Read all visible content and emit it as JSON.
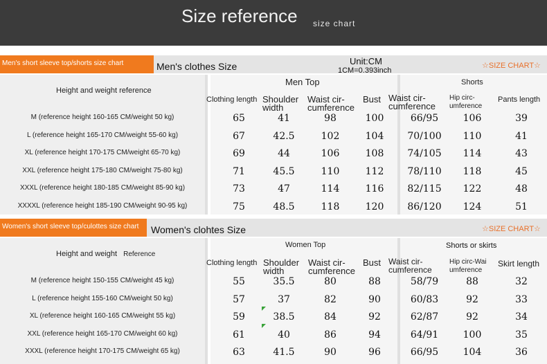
{
  "header": {
    "title": "Size reference",
    "subtitle": "size chart"
  },
  "men": {
    "tab_label": "Men's short sleeve top/shorts size chart",
    "section_label": "Men's clothes Size",
    "unit": "Unit:CM",
    "conversion": "1CM=0.393inch",
    "size_chart_label": "☆SIZE CHART☆",
    "ref_header": "Height and weight reference",
    "group_top": "Men Top",
    "group_shorts": "Shorts",
    "col_headers": {
      "clothing_length": "Clothing length",
      "shoulder_1": "Shoulder",
      "shoulder_2": "width",
      "waist_1": "Waist cir-",
      "waist_2": "cumference",
      "bust": "Bust",
      "s_waist_1": "Waist cir-",
      "s_waist_2": "cumference",
      "hip_1": "Hip circ-",
      "hip_2": "umference",
      "pants_length": "Pants length"
    },
    "rows": [
      {
        "ref": "M (reference height 160-165 CM/weight 50 kg)",
        "v": [
          "65",
          "41",
          "98",
          "100",
          "66/95",
          "106",
          "39"
        ]
      },
      {
        "ref": "L (reference height 165-170 CM/weight 55-60 kg)",
        "v": [
          "67",
          "42.5",
          "102",
          "104",
          "70/100",
          "110",
          "41"
        ]
      },
      {
        "ref": "XL (reference height 170-175 CM/weight 65-70 kg)",
        "v": [
          "69",
          "44",
          "106",
          "108",
          "74/105",
          "114",
          "43"
        ]
      },
      {
        "ref": "XXL (reference height 175-180 CM/weight 75-80 kg)",
        "v": [
          "71",
          "45.5",
          "110",
          "112",
          "78/110",
          "118",
          "45"
        ]
      },
      {
        "ref": "XXXL (reference height 180-185 CM/weight 85-90 kg)",
        "v": [
          "73",
          "47",
          "114",
          "116",
          "82/115",
          "122",
          "48"
        ]
      },
      {
        "ref": "XXXXL (reference height 185-190 CM/weight 90-95 kg)",
        "v": [
          "75",
          "48.5",
          "118",
          "120",
          "86/120",
          "124",
          "51"
        ]
      }
    ]
  },
  "women": {
    "tab_label": "Women's short sleeve top/culottes size chart",
    "section_label": "Women's clohtes Size",
    "size_chart_label": "☆SIZE CHART☆",
    "ref_header_1": "Height and weight",
    "ref_header_2": "Reference",
    "group_top": "Women Top",
    "group_shorts": "Shorts or skirts",
    "col_headers": {
      "clothing_length": "Clothing length",
      "shoulder_1": "Shoulder",
      "shoulder_2": "width",
      "waist_1": "Waist cir-",
      "waist_2": "cumference",
      "bust": "Bust",
      "s_waist_1": "Waist cir-",
      "s_waist_2": "cumference",
      "hip_1": "Hip circ-Wai",
      "hip_2": "umference",
      "skirt_length": "Skirt length"
    },
    "rows": [
      {
        "ref": "M (reference height 150-155 CM/weight 45 kg)",
        "v": [
          "55",
          "35.5",
          "80",
          "88",
          "58/79",
          "88",
          "32"
        ]
      },
      {
        "ref": "L (reference height 155-160 CM/weight 50 kg)",
        "v": [
          "57",
          "37",
          "82",
          "90",
          "60/83",
          "92",
          "33"
        ]
      },
      {
        "ref": "XL (reference height 160-165 CM/weight 55 kg)",
        "v": [
          "59",
          "38.5",
          "84",
          "92",
          "62/87",
          "92",
          "34"
        ]
      },
      {
        "ref": "XXL (reference height 165-170 CM/weight 60 kg)",
        "v": [
          "61",
          "40",
          "86",
          "94",
          "64/91",
          "100",
          "35"
        ]
      },
      {
        "ref": "XXXL (reference height 170-175 CM/weight 65 kg)",
        "v": [
          "63",
          "41.5",
          "90",
          "96",
          "66/95",
          "104",
          "36"
        ]
      }
    ]
  }
}
